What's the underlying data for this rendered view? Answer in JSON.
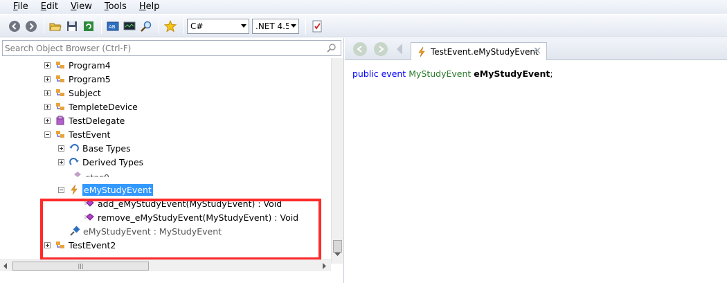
{
  "menu": [
    {
      "label": "File",
      "accel": "F",
      "rest": "ile"
    },
    {
      "label": "Edit",
      "accel": "E",
      "rest": "dit"
    },
    {
      "label": "View",
      "accel": "V",
      "rest": "iew"
    },
    {
      "label": "Tools",
      "accel": "T",
      "rest": "ools"
    },
    {
      "label": "Help",
      "accel": "H",
      "rest": "elp"
    }
  ],
  "toolbar": {
    "language": "C#",
    "framework": ".NET 4.5"
  },
  "search": {
    "placeholder": "Search Object Browser (Ctrl-F)"
  },
  "tree": {
    "items": [
      {
        "label": "Program4",
        "icon": "class-icon"
      },
      {
        "label": "Program5",
        "icon": "class-icon"
      },
      {
        "label": "Subject",
        "icon": "class-icon"
      },
      {
        "label": "TempleteDevice",
        "icon": "class-icon"
      },
      {
        "label": "TestDelegate",
        "icon": "delegate-icon"
      },
      {
        "label": "TestEvent",
        "icon": "class-icon"
      },
      {
        "label": "Base Types",
        "icon": "base-types-icon"
      },
      {
        "label": "Derived Types",
        "icon": "derived-types-icon"
      },
      {
        "label": "stac0",
        "icon": "member-icon"
      },
      {
        "label": "eMyStudyEvent",
        "icon": "event-icon"
      },
      {
        "label": "add_eMyStudyEvent(MyStudyEvent) : Void",
        "icon": "method-icon"
      },
      {
        "label": "remove_eMyStudyEvent(MyStudyEvent) : Void",
        "icon": "method-icon"
      },
      {
        "label": "eMyStudyEvent : MyStudyEvent",
        "icon": "field-icon"
      },
      {
        "label": "TestEvent2",
        "icon": "class-icon"
      }
    ]
  },
  "tab": {
    "title": "TestEvent.eMyStudyEvent"
  },
  "code": {
    "kw1": "public",
    "kw2": "event",
    "type": "MyStudyEvent",
    "member": "eMyStudyEvent",
    "end": ";"
  },
  "colors": {
    "selection": "#3399ff",
    "highlight_box": "#ff2a2a",
    "keyword": "#0000ff",
    "type": "#2b7a2b"
  }
}
